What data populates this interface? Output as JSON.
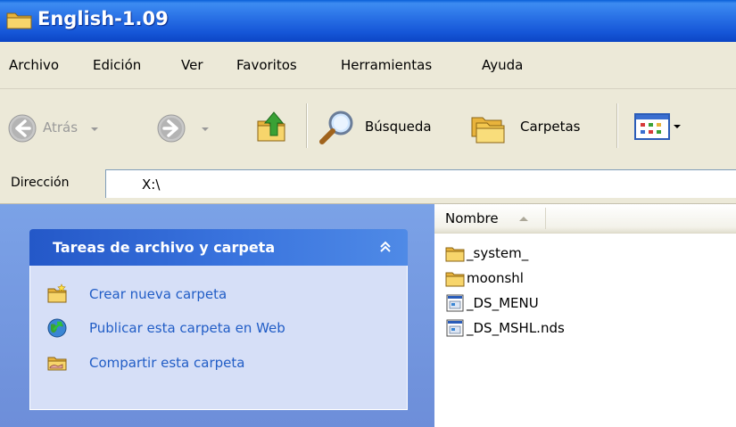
{
  "window": {
    "title": "English-1.09"
  },
  "menubar": {
    "items": [
      "Archivo",
      "Edición",
      "Ver",
      "Favoritos",
      "Herramientas",
      "Ayuda"
    ]
  },
  "toolbar": {
    "back_label": "Atrás",
    "search_label": "Búsqueda",
    "folders_label": "Carpetas",
    "icons": [
      "back-arrow-icon",
      "forward-arrow-icon",
      "up-folder-icon",
      "search-magnifier-icon",
      "folders-icon",
      "views-icon"
    ]
  },
  "address": {
    "label": "Dirección",
    "value": "X:\\"
  },
  "task_pane": {
    "title": "Tareas de archivo y carpeta",
    "collapse_glyph": "«",
    "links": [
      {
        "label": "Crear nueva carpeta",
        "icon": "new-folder-icon"
      },
      {
        "label": "Publicar esta carpeta en Web",
        "icon": "publish-web-icon"
      },
      {
        "label": "Compartir esta carpeta",
        "icon": "share-folder-icon"
      }
    ]
  },
  "file_list": {
    "column_header": "Nombre",
    "files": [
      {
        "name": "_system_",
        "type": "folder"
      },
      {
        "name": "moonshl",
        "type": "folder"
      },
      {
        "name": "_DS_MENU",
        "type": "nds-file"
      },
      {
        "name": "_DS_MSHL.nds",
        "type": "nds-file"
      }
    ]
  },
  "colors": {
    "title_bar": "#2a72e6",
    "chrome": "#ece9d8",
    "task_pane_bg": "#7ba2e7",
    "task_header": "#2458c8",
    "task_body": "#d6dff7",
    "link_text": "#215dc6"
  }
}
